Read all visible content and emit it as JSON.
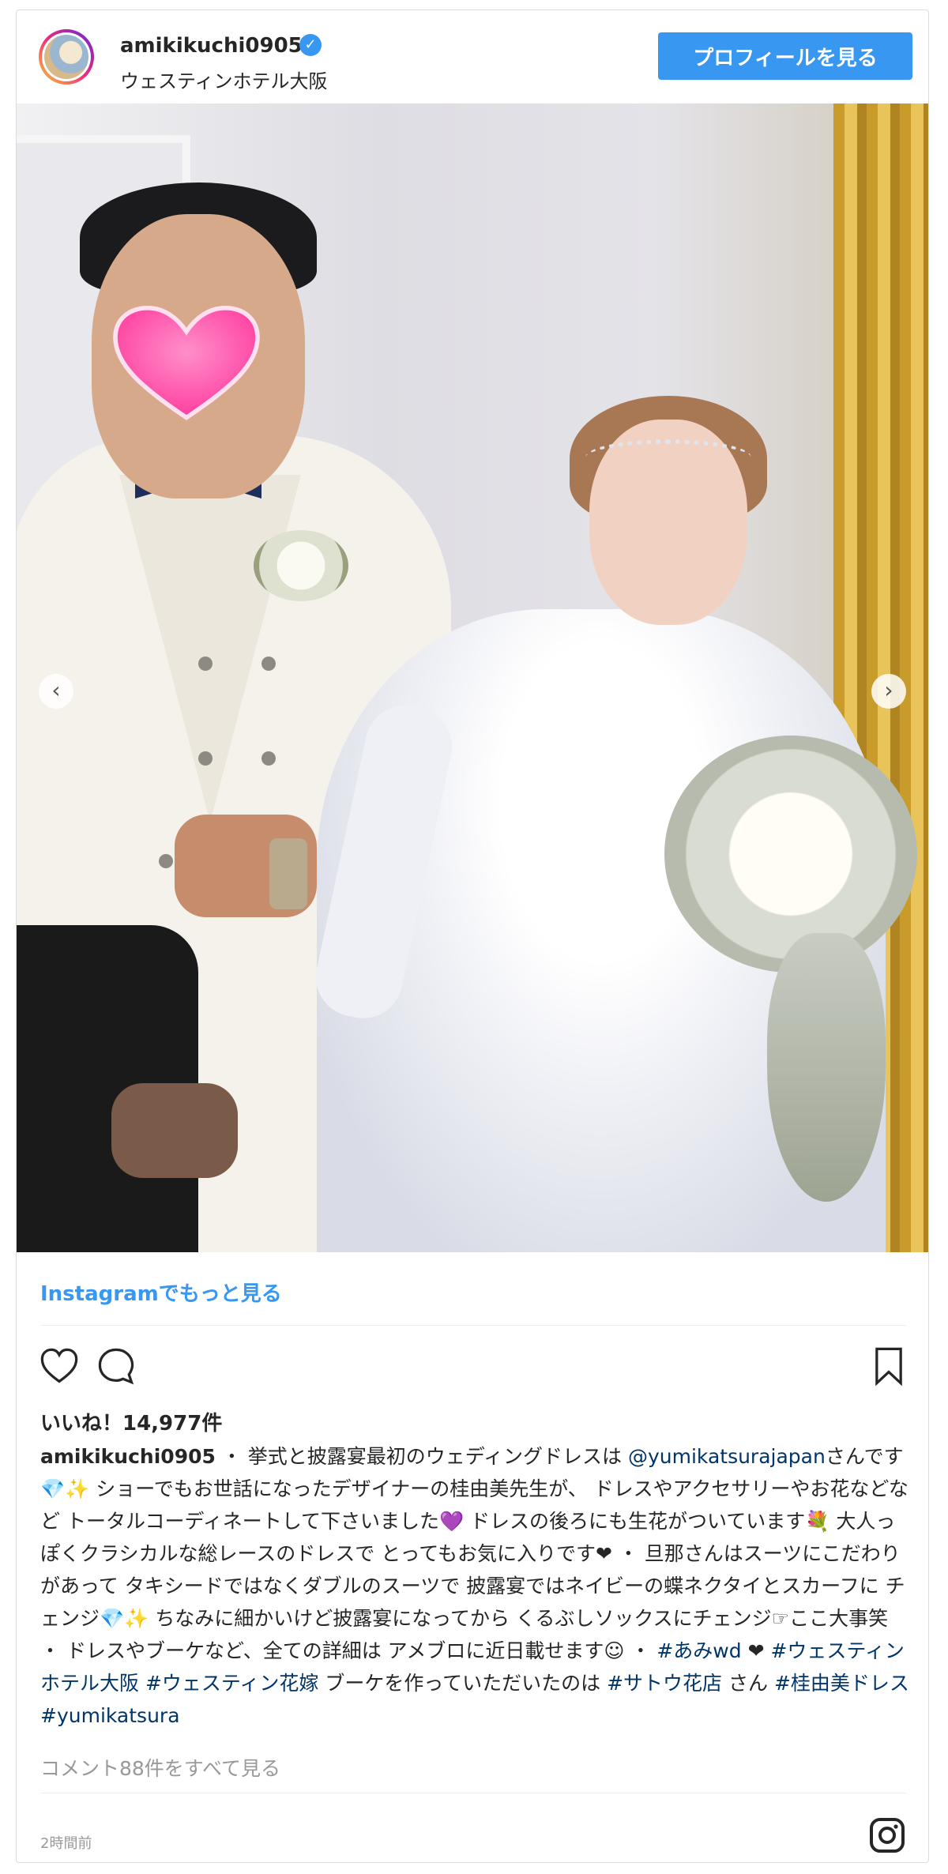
{
  "header": {
    "username": "amikikuchi0905",
    "verified_mark": "✓",
    "location": "ウェスティンホテル大阪",
    "profile_button_label": "プロフィールを見る"
  },
  "carousel": {
    "prev_glyph": "‹",
    "next_glyph": "›"
  },
  "more_link": "Instagramでもっと見る",
  "likes": "いいね！14,977件",
  "caption": {
    "username": "amikikuchi0905",
    "line1": " ・ 挙式と披露宴最初のウェディングドレスは ",
    "mention": "@yumikatsurajapan",
    "line2": "さんです💎✨ ショーでもお世話になったデザイナーの桂由美先生が、 ドレスやアクセサリーやお花などなど トータルコーディネートして下さいました💜 ドレスの後ろにも生花がついています💐 大人っぽくクラシカルな総レースのドレスで とってもお気に入りです❤ ・ 旦那さんはスーツにこだわりがあって タキシードではなくダブルのスーツで 披露宴ではネイビーの蝶ネクタイとスカーフに チェンジ💎✨ ちなみに細かいけど披露宴になってから くるぶしソックスにチェンジ☞ここ大事笑 ・ ドレスやブーケなど、全ての詳細は アメブロに近日載せます☺ ・ ",
    "tag1": "#あみwd",
    "heart": " ❤ ",
    "tag2": "#ウェスティンホテル大阪",
    "tag3": "#ウェスティン花嫁",
    "line3": " ブーケを作っていただいたのは ",
    "tag4": "#サトウ花店",
    "line4": " さん ",
    "tag5": "#桂由美ドレス",
    "tag6": "#yumikatsura"
  },
  "comments_link": "コメント88件をすべて見る",
  "timestamp": "2時間前",
  "colors": {
    "accent": "#3897f0",
    "hashtag": "#003569",
    "muted": "#999999"
  }
}
